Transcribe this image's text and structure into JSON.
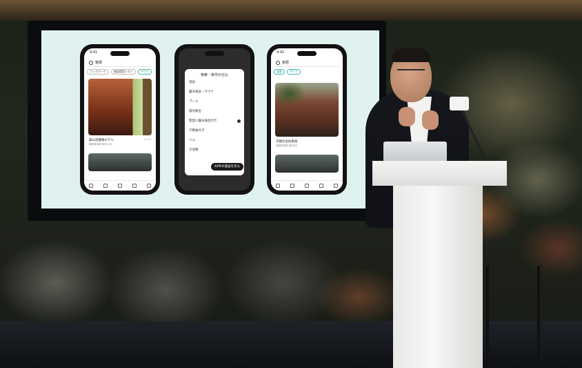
{
  "scene": {
    "colors": {
      "screen_bg": "#dff2f0",
      "accent_teal": "#39b9ad",
      "podium": "#f2f2f0",
      "suit": "#15171d",
      "flower_orange": "#dc7846"
    }
  },
  "phones": {
    "left": {
      "status_time": "9:41",
      "search_text": "箱根",
      "chips": [
        "ブックマーク",
        "施設提案リスト",
        "サウナ"
      ],
      "card_title": "奥山荘箱根ホテル",
      "card_sub": "箱根湯本駅 徒歩10分",
      "card_meta": "★ 4.5"
    },
    "middle": {
      "sheet_title": "検索・条件の仕込",
      "rows": [
        {
          "label": "温泉",
          "sub": ""
        },
        {
          "label": "露天風呂・サウナ",
          "sub": ""
        },
        {
          "label": "プール",
          "sub": ""
        },
        {
          "label": "貸切風呂",
          "sub": ""
        },
        {
          "label": "客室に露天風呂付き",
          "sub": ""
        },
        {
          "label": "夕朝食付き",
          "sub": ""
        },
        {
          "label": "ジム",
          "sub": ""
        },
        {
          "label": "大浴場",
          "sub": ""
        }
      ],
      "cta_label": "48件の施設を見る"
    },
    "right": {
      "status_time": "9:41",
      "search_text": "箱根",
      "chips": [
        "温泉",
        "サウナ"
      ],
      "card_title": "京都の古民家宿",
      "card_sub": "祇園四条駅 徒歩8分"
    }
  },
  "mic": {
    "flag_text": "mic"
  }
}
